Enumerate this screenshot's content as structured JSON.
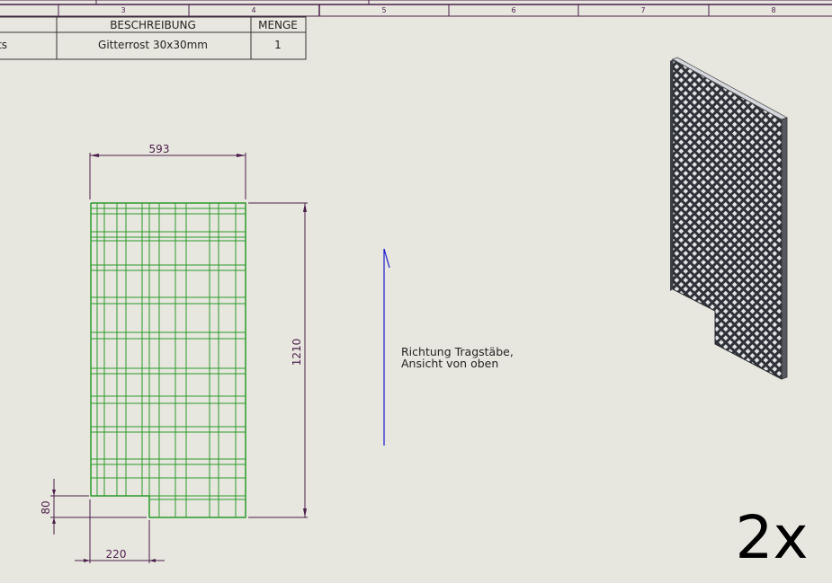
{
  "zone_labels": [
    "3",
    "4",
    "5",
    "6",
    "7",
    "8"
  ],
  "bom": {
    "headers": {
      "description": "BESCHREIBUNG",
      "quantity": "MENGE"
    },
    "row": {
      "part_fragment": "ts",
      "description": "Gitterrost 30x30mm",
      "quantity": "1"
    }
  },
  "dimensions": {
    "width": "593",
    "height": "1210",
    "notch_height": "80",
    "notch_width": "220"
  },
  "note": {
    "line1": "Richtung Tragstäbe,",
    "line2": "Ansicht von oben"
  },
  "quantity_label": "2x",
  "colors": {
    "background": "#e8e7df",
    "dimension": "#4a1d4a",
    "grating_lines": "#2a9a2a",
    "direction_arrow": "#1a1acc",
    "iso_grating": "#2f3238"
  }
}
